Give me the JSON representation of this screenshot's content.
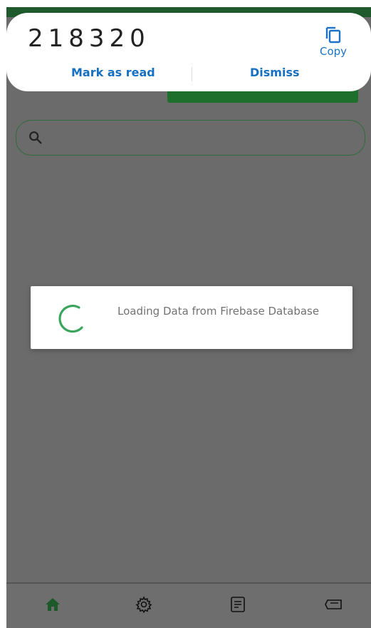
{
  "notification": {
    "code": "218320",
    "copy_label": "Copy",
    "mark_read_label": "Mark as read",
    "dismiss_label": "Dismiss"
  },
  "search": {
    "placeholder": ""
  },
  "loading": {
    "message": "Loading Data from Firebase Database"
  },
  "bottom_nav": {
    "items": [
      {
        "icon": "home-icon",
        "active": true
      },
      {
        "icon": "gear-icon",
        "active": false
      },
      {
        "icon": "document-icon",
        "active": false
      },
      {
        "icon": "ticket-icon",
        "active": false
      }
    ]
  },
  "colors": {
    "accent_green": "#1e6f2c",
    "spinner_green": "#3aa55c",
    "link_blue": "#1670c1",
    "overlay_gray": "#6b6b6b"
  }
}
